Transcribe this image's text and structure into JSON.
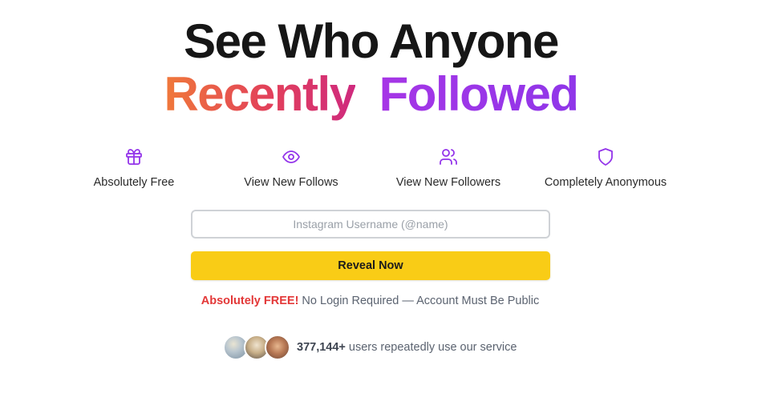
{
  "headline": {
    "line1": "See Who Anyone",
    "line2_part1": "Recently",
    "line2_part2": "Followed"
  },
  "features": [
    {
      "icon": "gift-icon",
      "label": "Absolutely Free"
    },
    {
      "icon": "eye-icon",
      "label": "View New Follows"
    },
    {
      "icon": "users-icon",
      "label": "View New Followers"
    },
    {
      "icon": "shield-icon",
      "label": "Completely Anonymous"
    }
  ],
  "form": {
    "username_placeholder": "Instagram Username (@name)",
    "username_value": "",
    "submit_label": "Reveal Now"
  },
  "note": {
    "highlight": "Absolutely FREE!",
    "text": " No Login Required — Account Must Be Public"
  },
  "social_proof": {
    "count": "377,144+",
    "text": " users repeatedly use our service"
  },
  "colors": {
    "accent_yellow": "#f9cc16",
    "icon_purple": "#9333ea",
    "free_red": "#e33838"
  }
}
